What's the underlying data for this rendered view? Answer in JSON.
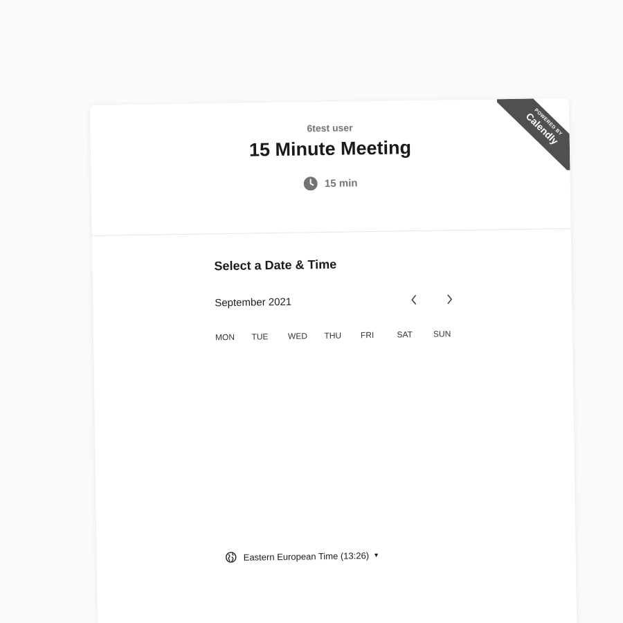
{
  "header": {
    "host_name": "6test user",
    "event_title": "15 Minute Meeting",
    "duration": "15 min"
  },
  "ribbon": {
    "small": "POWERED BY",
    "brand": "Calendly"
  },
  "scheduler": {
    "section_title": "Select a Date & Time",
    "month": "September 2021",
    "weekdays": [
      "MON",
      "TUE",
      "WED",
      "THU",
      "FRI",
      "SAT",
      "SUN"
    ]
  },
  "timezone": {
    "label": "Eastern European Time (13:26)"
  },
  "icons": {
    "duration": "clock-icon",
    "prev": "chevron-left-icon",
    "next": "chevron-right-icon",
    "timezone": "globe-icon",
    "dropdown": "caret-down-icon"
  },
  "colors": {
    "muted_text": "#737373",
    "ribbon_bg": "#505050"
  }
}
